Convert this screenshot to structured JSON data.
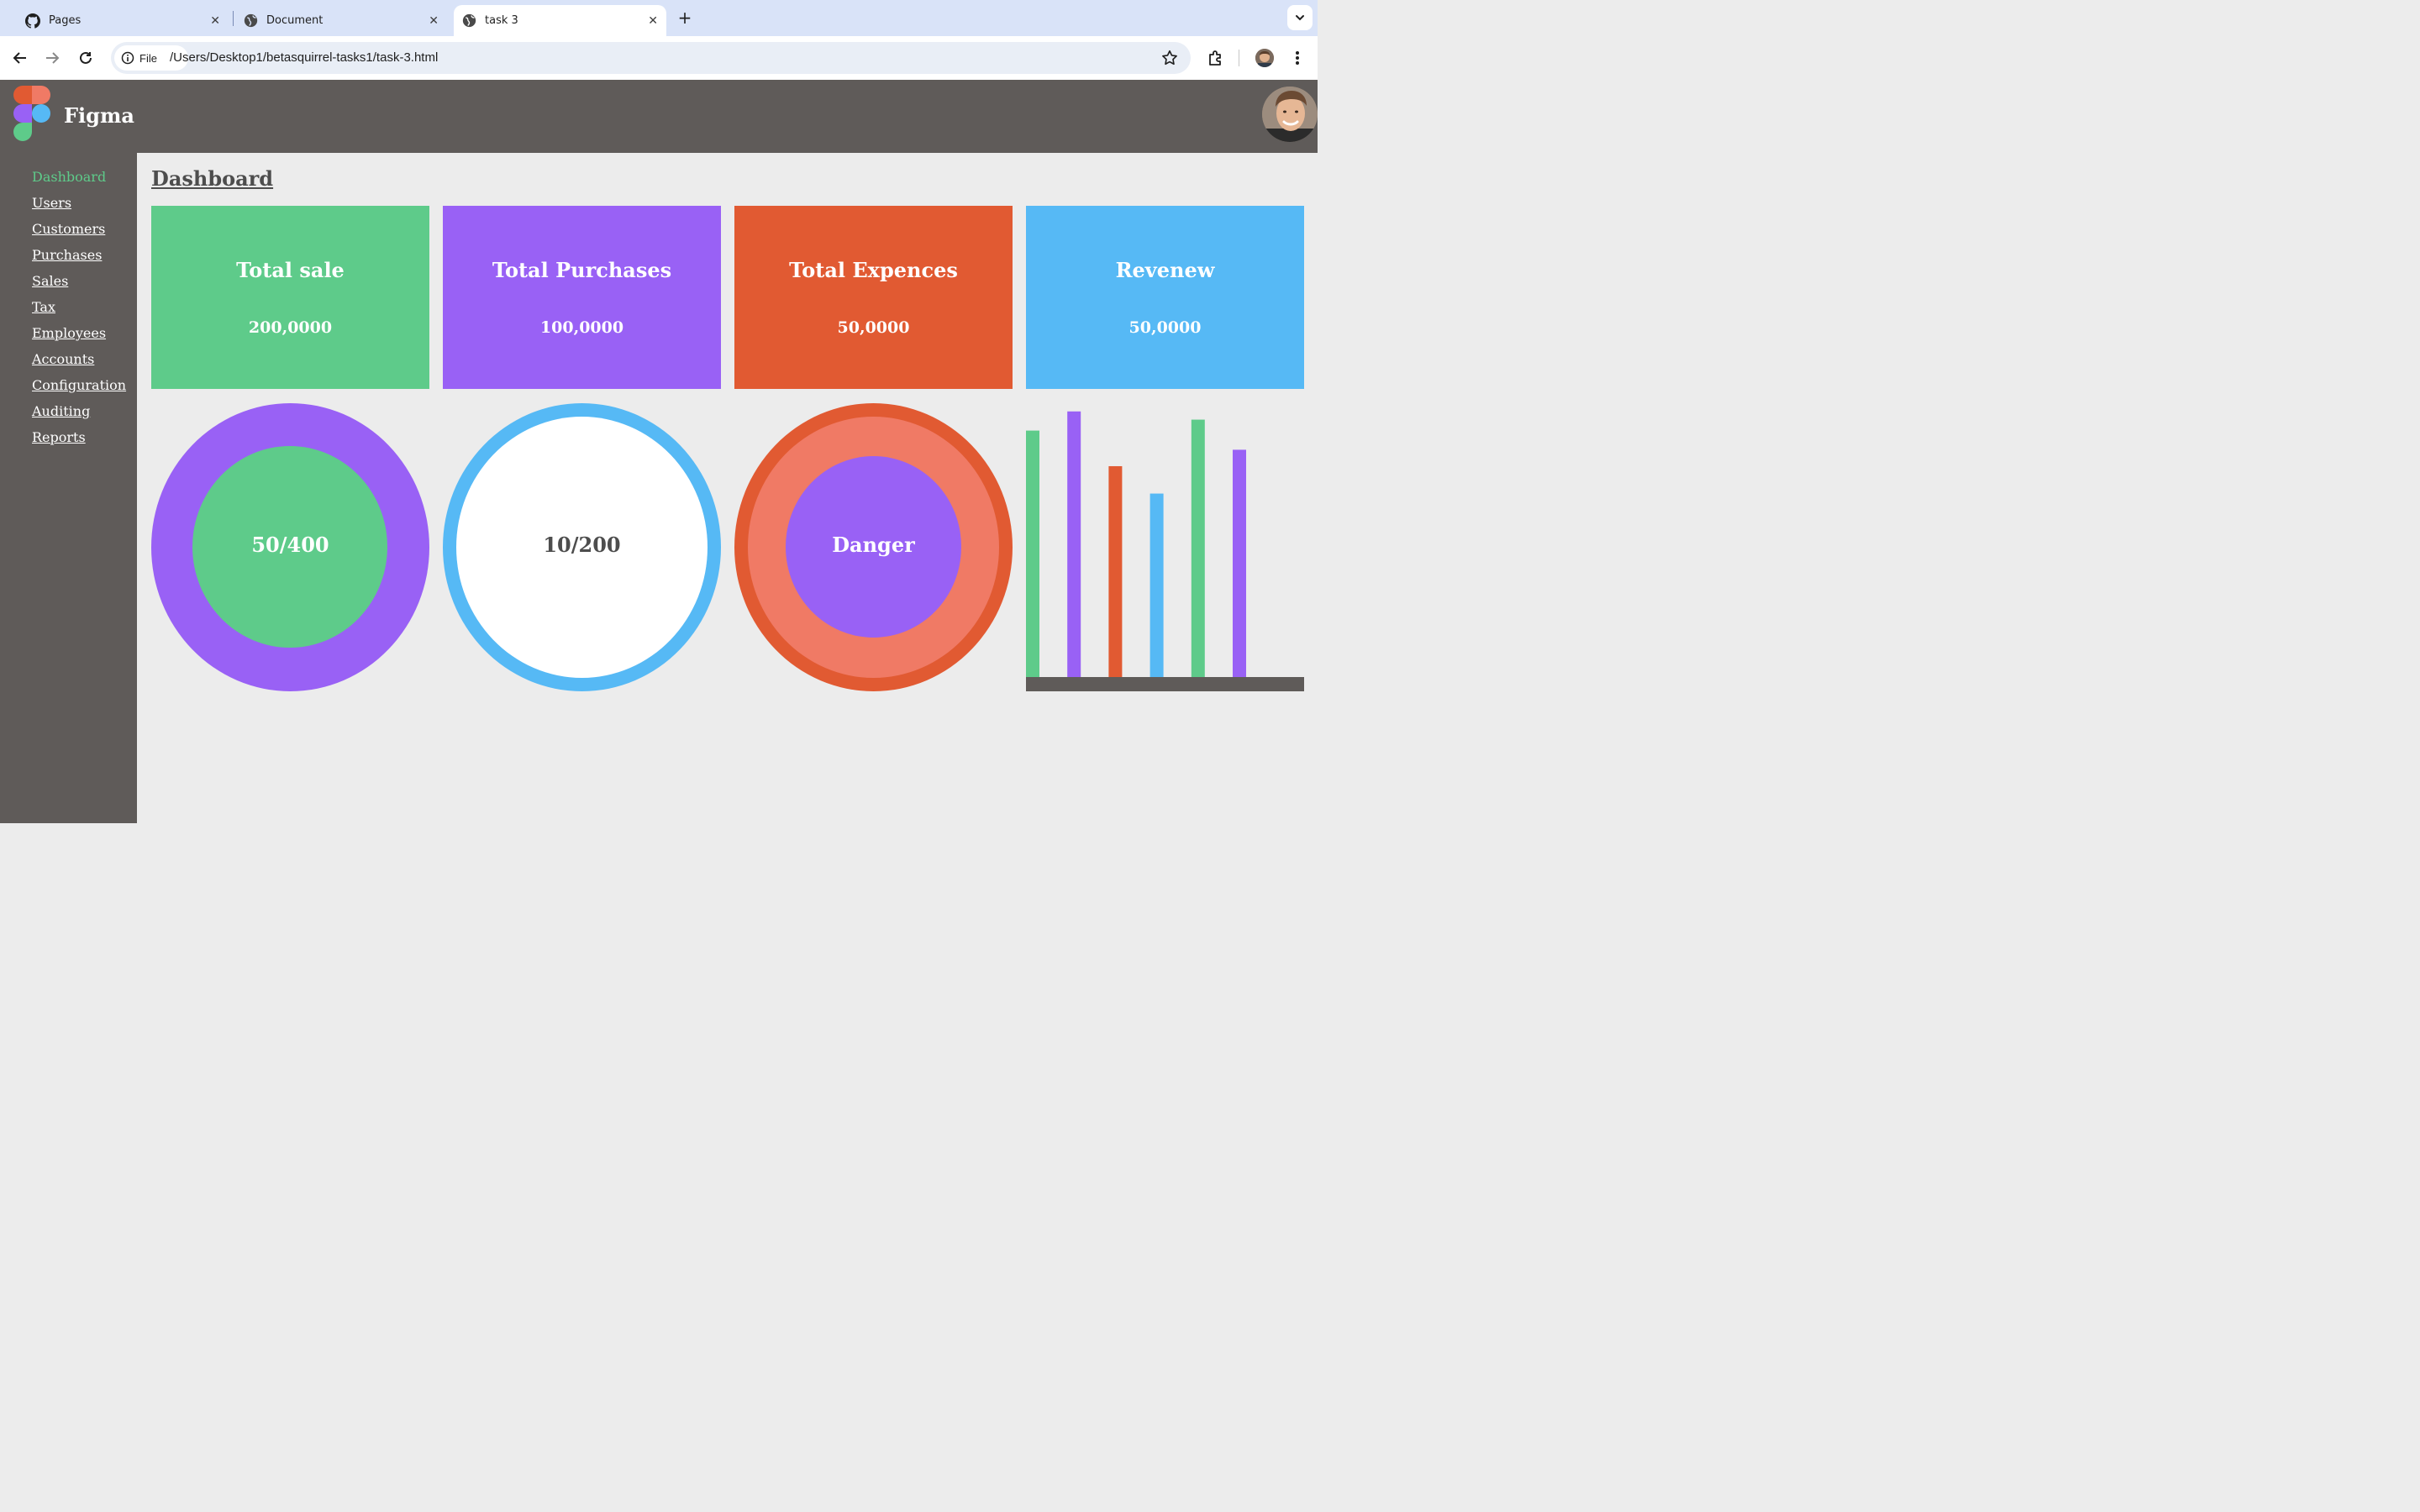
{
  "browser": {
    "tabs": [
      {
        "title": "Pages",
        "icon": "github-icon"
      },
      {
        "title": "Document",
        "icon": "globe-icon"
      },
      {
        "title": "task 3",
        "icon": "globe-icon",
        "active": true
      }
    ],
    "address": {
      "chip_label": "File",
      "url": "/Users/Desktop1/betasquirrel-tasks1/task-3.html"
    }
  },
  "app": {
    "brand": "Figma",
    "page_title": "Dashboard",
    "nav": [
      {
        "label": "Dashboard",
        "active": true
      },
      {
        "label": "Users"
      },
      {
        "label": "Customers"
      },
      {
        "label": "Purchases"
      },
      {
        "label": "Sales"
      },
      {
        "label": "Tax"
      },
      {
        "label": "Employees"
      },
      {
        "label": "Accounts"
      },
      {
        "label": "Configuration"
      },
      {
        "label": "Auditing"
      },
      {
        "label": "Reports"
      }
    ],
    "cards": [
      {
        "title": "Total sale",
        "value": "200,0000",
        "color": "#5ecb8a"
      },
      {
        "title": "Total Purchases",
        "value": "100,0000",
        "color": "#9961f5"
      },
      {
        "title": "Total Expences",
        "value": "50,0000",
        "color": "#e15a32"
      },
      {
        "title": "Revenew",
        "value": "50,0000",
        "color": "#56b9f5"
      }
    ],
    "rings": [
      {
        "label": "50/400",
        "outer": "#9961f5",
        "inner": "#5ecb8a",
        "label_color": "#ffffff"
      },
      {
        "label": "10/200",
        "outer": "#56b9f5",
        "inner": "#ffffff",
        "label_color": "#4d4d4d"
      },
      {
        "label": "Danger",
        "outer": "#e15a32",
        "middle": "#f07a65",
        "inner": "#9961f5",
        "label_color": "#ffffff"
      }
    ]
  },
  "chart_data": {
    "type": "bar",
    "values": [
      90,
      97,
      77,
      67,
      94,
      83
    ],
    "colors": [
      "#5ecb8a",
      "#9961f5",
      "#e15a32",
      "#56b9f5",
      "#5ecb8a",
      "#9961f5"
    ],
    "ylim": [
      0,
      100
    ],
    "baseline_color": "#5f5b59"
  }
}
